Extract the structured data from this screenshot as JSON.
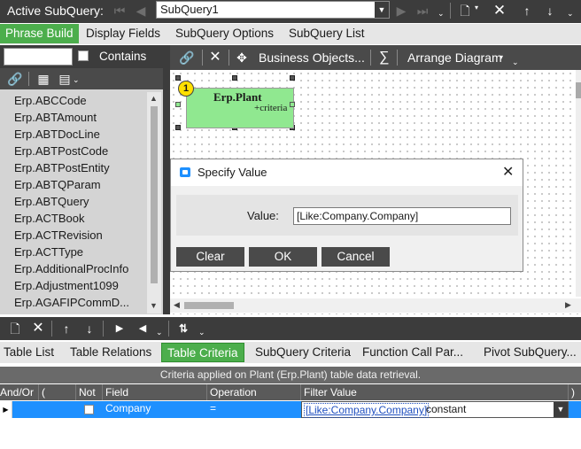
{
  "top_toolbar": {
    "label": "Active SubQuery:",
    "subquery_value": "SubQuery1",
    "icons": [
      "first-icon",
      "prev-icon",
      "next-icon",
      "last-icon",
      "new-icon",
      "delete-icon",
      "move-up-icon",
      "move-down-icon"
    ]
  },
  "main_tabs": [
    {
      "label": "Phrase Build",
      "active": true
    },
    {
      "label": "Display Fields",
      "active": false
    },
    {
      "label": "SubQuery Options",
      "active": false
    },
    {
      "label": "SubQuery List",
      "active": false
    }
  ],
  "left_panel": {
    "search_value": "",
    "contains_label": "Contains",
    "tables": [
      "Erp.ABCCode",
      "Erp.ABTAmount",
      "Erp.ABTDocLine",
      "Erp.ABTPostCode",
      "Erp.ABTPostEntity",
      "Erp.ABTQParam",
      "Erp.ABTQuery",
      "Erp.ACTBook",
      "Erp.ACTRevision",
      "Erp.ACTType",
      "Erp.AdditionalProcInfo",
      "Erp.Adjustment1099",
      "Erp.AGAFIPCommD..."
    ]
  },
  "diagram_toolbar": {
    "business_objects_label": "Business Objects...",
    "sigma_symbol": "∑",
    "arrange_label": "Arrange Diagram"
  },
  "diagram": {
    "table_badge": "1",
    "table_name": "Erp.Plant",
    "table_criteria": "+criteria"
  },
  "dialog": {
    "title": "Specify Value",
    "value_label": "Value:",
    "value": "[Like:Company.Company]",
    "clear_label": "Clear",
    "ok_label": "OK",
    "cancel_label": "Cancel"
  },
  "bottom_tabs": [
    {
      "label": "Table List",
      "active": false
    },
    {
      "label": "Table Relations",
      "active": false
    },
    {
      "label": "Table Criteria",
      "active": true
    },
    {
      "label": "SubQuery Criteria",
      "active": false
    },
    {
      "label": "Function Call Par...",
      "active": false
    },
    {
      "label": "Pivot SubQuery...",
      "active": false
    }
  ],
  "criteria": {
    "info": "Criteria applied on Plant (Erp.Plant) table data retrieval.",
    "columns": [
      "And/Or",
      "(",
      "Not",
      "Field",
      "Operation",
      "Filter Value",
      ")"
    ],
    "row": {
      "field": "Company",
      "operation": "=",
      "filter_link": "[Like:Company.Company]",
      "filter_suffix": "constant"
    }
  },
  "colors": {
    "accent_green": "#4cae4c",
    "dark_toolbar": "#3c3c3c",
    "row_selected": "#1e90ff"
  }
}
